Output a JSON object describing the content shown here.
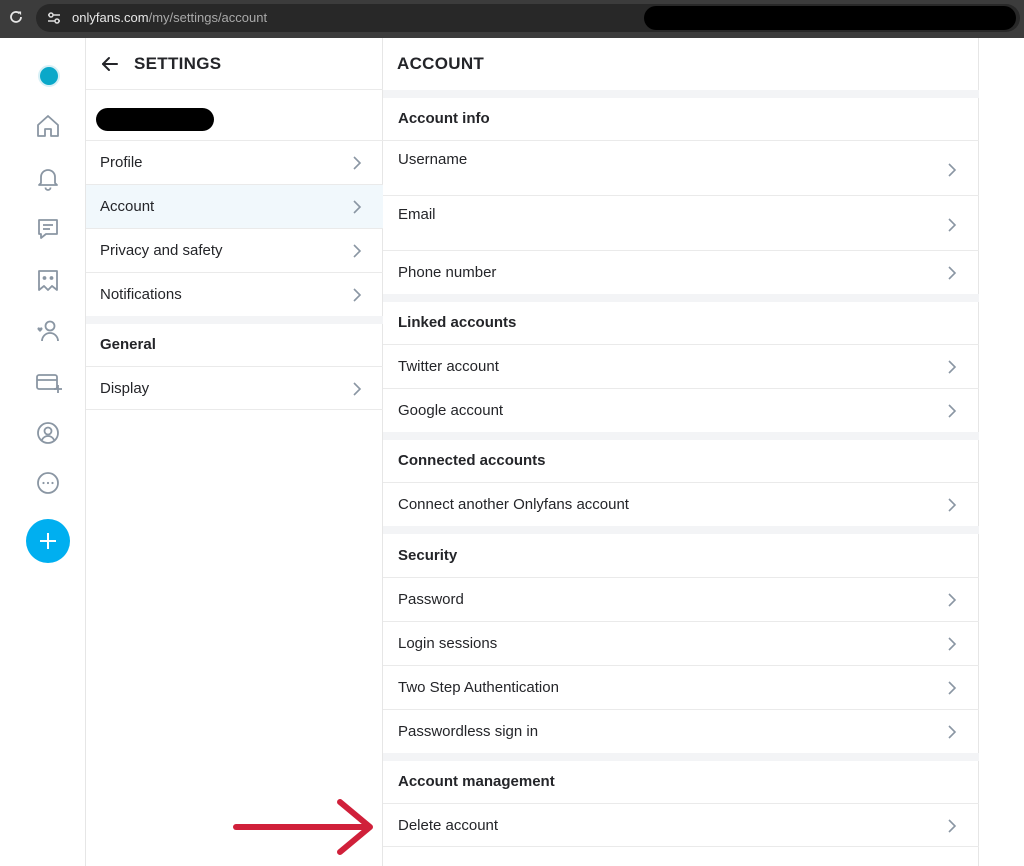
{
  "browser": {
    "url_host": "onlyfans.com",
    "url_path": "/my/settings/account"
  },
  "rail": {
    "icons": [
      "home-icon",
      "bell-icon",
      "chat-icon",
      "collections-icon",
      "subscriptions-icon",
      "card-icon",
      "profile-icon",
      "more-icon",
      "plus-icon"
    ],
    "accent": "#00aff0"
  },
  "settings": {
    "title": "SETTINGS",
    "items": [
      {
        "label": "Profile"
      },
      {
        "label": "Account"
      },
      {
        "label": "Privacy and safety"
      },
      {
        "label": "Notifications"
      }
    ],
    "general": {
      "heading": "General",
      "items": [
        {
          "label": "Display"
        }
      ]
    }
  },
  "account": {
    "title": "ACCOUNT",
    "sections": [
      {
        "heading": "Account info",
        "items": [
          "Username",
          "Email",
          "Phone number"
        ]
      },
      {
        "heading": "Linked accounts",
        "items": [
          "Twitter account",
          "Google account"
        ]
      },
      {
        "heading": "Connected accounts",
        "items": [
          "Connect another Onlyfans account"
        ]
      },
      {
        "heading": "Security",
        "items": [
          "Password",
          "Login sessions",
          "Two Step Authentication",
          "Passwordless sign in"
        ]
      },
      {
        "heading": "Account management",
        "items": [
          "Delete account"
        ]
      }
    ]
  },
  "annotation": {
    "arrow_color": "#d0203a"
  }
}
